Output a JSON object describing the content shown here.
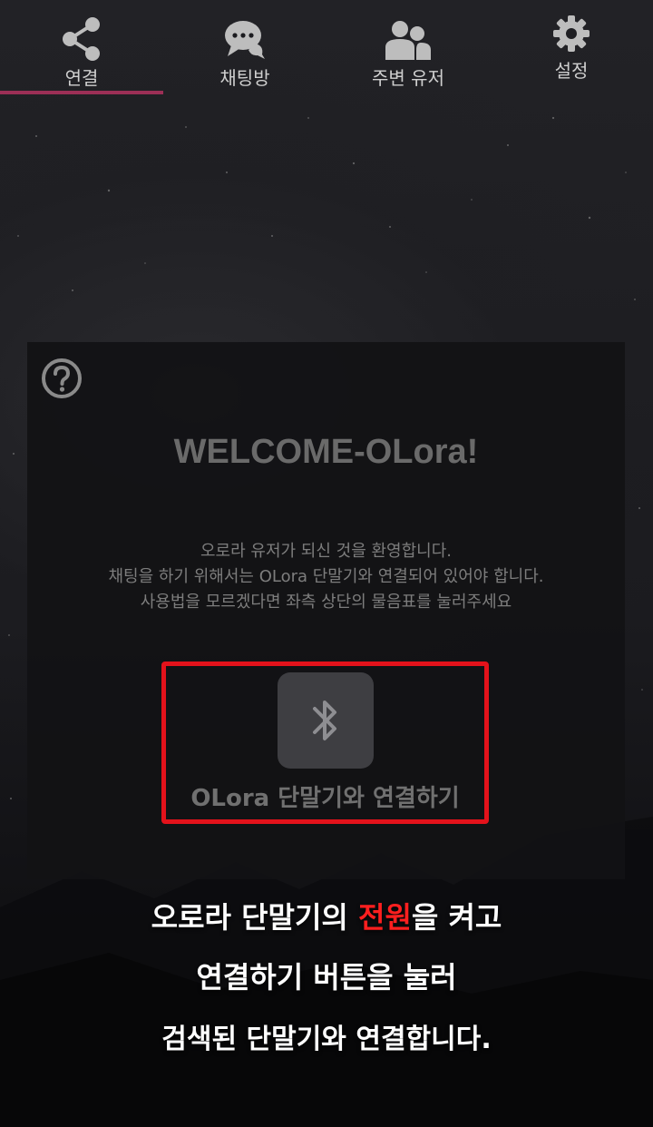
{
  "tabs": [
    {
      "label": "연결",
      "icon": "share-icon",
      "active": true
    },
    {
      "label": "채팅방",
      "icon": "chat-bubbles-icon",
      "active": false
    },
    {
      "label": "주변 유저",
      "icon": "users-icon",
      "active": false
    },
    {
      "label": "설정",
      "icon": "gear-icon",
      "active": false
    }
  ],
  "card": {
    "help_icon": "question-circle-icon",
    "title": "WELCOME-OLora!",
    "description_lines": [
      "오로라 유저가 되신 것을 환영합니다.",
      "채팅을 하기 위해서는 OLora 단말기와 연결되어 있어야 합니다.",
      "사용법을 모르겠다면 좌측 상단의 물음표를 눌러주세요"
    ],
    "bluetooth_icon": "bluetooth-icon",
    "connect_label": "OLora 단말기와 연결하기"
  },
  "instructions": {
    "line1_before": "오로라 단말기의 ",
    "line1_highlight": "전원",
    "line1_after": "을 켜고",
    "line2": "연결하기 버튼을 눌러",
    "line3": "검색된 단말기와 연결합니다."
  },
  "colors": {
    "accent": "#9c2f56",
    "highlight_box": "#e3121b",
    "highlight_text": "#ff1f1f"
  }
}
